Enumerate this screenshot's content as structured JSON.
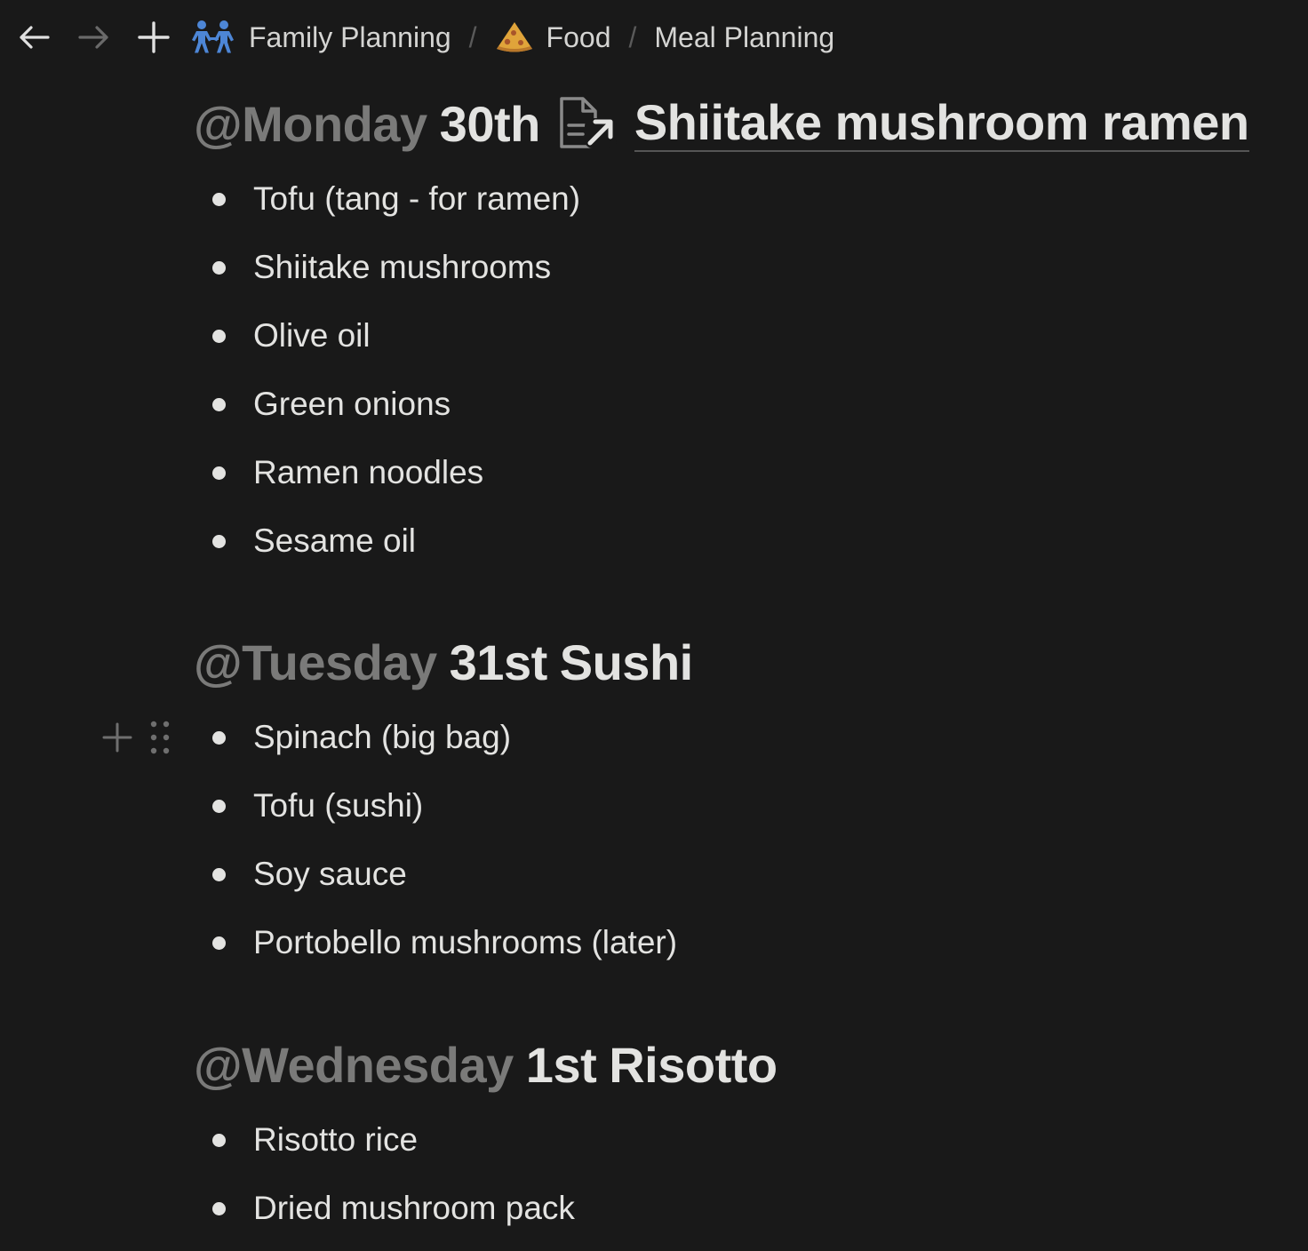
{
  "nav": {
    "back_icon": "arrow-left-icon",
    "forward_icon": "arrow-right-icon",
    "new_icon": "plus-icon"
  },
  "breadcrumb": [
    {
      "label": "Family Planning",
      "icon": "people-holding-hands-icon"
    },
    {
      "label": "Food",
      "icon": "pizza-slice-icon"
    },
    {
      "label": "Meal Planning",
      "icon": ""
    }
  ],
  "breadcrumb_separator": "/",
  "days": [
    {
      "mention": "@Monday",
      "date": "30th",
      "title": "",
      "linked_page": {
        "icon": "page-link-icon",
        "title": "Shiitake mushroom ramen"
      },
      "items": [
        "Tofu (tang - for ramen)",
        "Shiitake mushrooms",
        "Olive oil",
        "Green onions",
        "Ramen noodles",
        "Sesame oil"
      ]
    },
    {
      "mention": "@Tuesday",
      "date": "31st",
      "title": "Sushi",
      "items": [
        "Spinach (big bag)",
        "Tofu (sushi)",
        "Soy sauce",
        "Portobello mushrooms (later)"
      ]
    },
    {
      "mention": "@Wednesday",
      "date": "1st",
      "title": "Risotto",
      "items": [
        "Risotto rice",
        "Dried mushroom pack"
      ]
    }
  ],
  "block_tools": {
    "add_icon": "plus-icon",
    "drag_icon": "drag-handle-icon"
  },
  "colors": {
    "background": "#191919",
    "text": "#e3e3e1",
    "mention": "#7a7a79",
    "muted": "#5a5a5a"
  }
}
